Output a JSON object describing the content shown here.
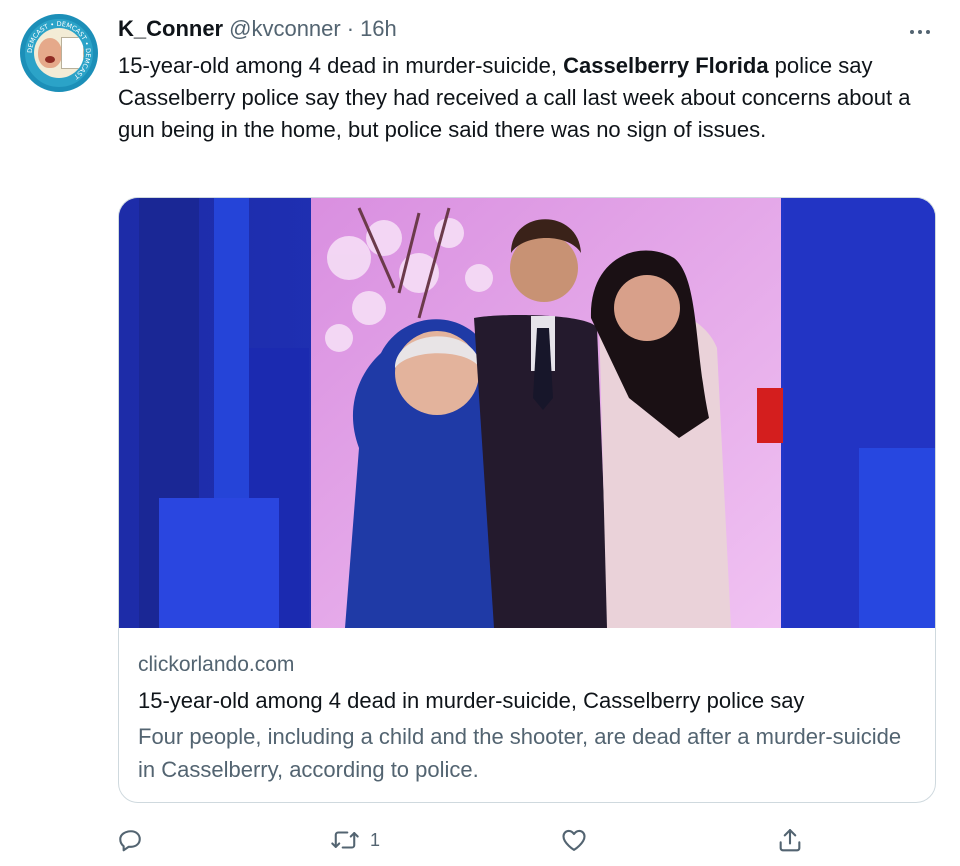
{
  "tweet": {
    "author": {
      "display_name": "K_Conner",
      "handle": "@kvconner",
      "separator": "·",
      "time": "16h",
      "avatar_ring_text": "DEMCAST • DEMCAST • DEMCAST",
      "avatar_card_text": "Can Take It Anymore"
    },
    "text": {
      "line1_before": "15-year-old among 4 dead in murder-suicide, ",
      "line1_bold": "Casselberry  Florida",
      "line1_after": " police say",
      "paragraph2": "Casselberry police say they had received a call last week about concerns about a gun being in the home, but police said there was no sign of issues."
    },
    "link_card": {
      "domain": "clickorlando.com",
      "title": "15-year-old among 4 dead in murder-suicide, Casselberry police say",
      "description": "Four people, including a child and the shooter, are dead after a murder-suicide in Casselberry, according to police."
    },
    "actions": {
      "reply": {
        "icon": "reply-icon",
        "count": ""
      },
      "retweet": {
        "icon": "retweet-icon",
        "count": "1"
      },
      "like": {
        "icon": "heart-icon",
        "count": ""
      },
      "share": {
        "icon": "share-icon",
        "count": ""
      }
    },
    "colors": {
      "text_primary": "#0f1419",
      "text_secondary": "#536471",
      "card_border": "#cfd9de",
      "image_blue": "#1e2fb8",
      "image_pink": "#e2a9e6"
    }
  }
}
